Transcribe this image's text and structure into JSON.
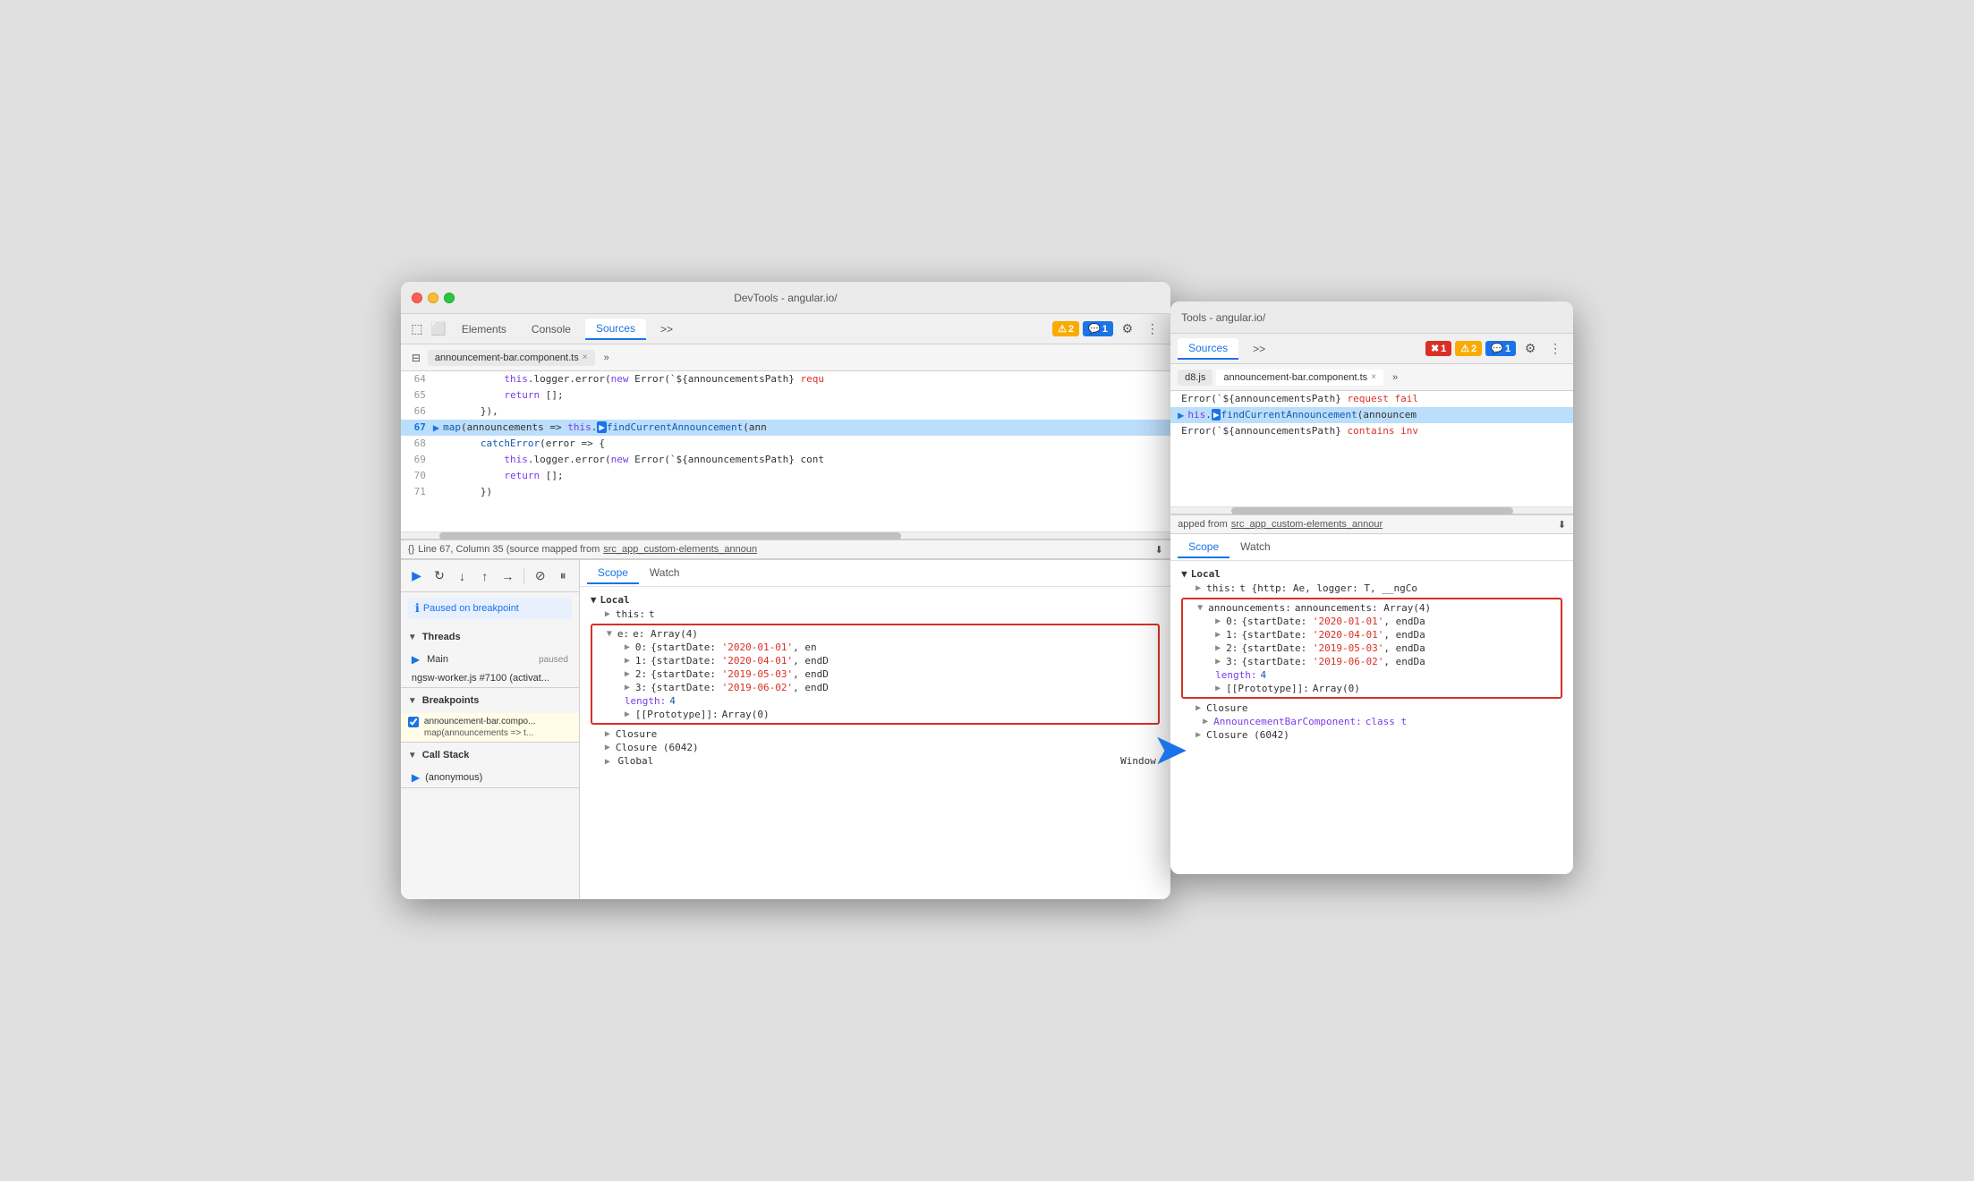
{
  "left_window": {
    "title": "DevTools - angular.io/",
    "tabs": [
      "Elements",
      "Console",
      "Sources",
      ">>"
    ],
    "active_tab": "Sources",
    "badges": [
      {
        "icon": "⚠",
        "count": "2",
        "type": "yellow"
      },
      {
        "icon": "💬",
        "count": "1",
        "type": "blue"
      }
    ],
    "file_tabs": [
      "announcement-bar.component.ts"
    ],
    "code_lines": [
      {
        "num": "64",
        "content": "            this.logger.error(new Error(`${announcementsPath} requ",
        "highlighted": false
      },
      {
        "num": "65",
        "content": "            return [];",
        "highlighted": false
      },
      {
        "num": "66",
        "content": "        }),",
        "highlighted": false
      },
      {
        "num": "67",
        "content": "        map(announcements => this.findCurrentAnnouncement(anno",
        "highlighted": true
      },
      {
        "num": "68",
        "content": "        catchError(error => {",
        "highlighted": false
      },
      {
        "num": "69",
        "content": "            this.logger.error(new Error(`${announcementsPath} cont",
        "highlighted": false
      },
      {
        "num": "70",
        "content": "            return [];",
        "highlighted": false
      },
      {
        "num": "71",
        "content": "        })",
        "highlighted": false
      }
    ],
    "status_bar": "Line 67, Column 35 (source mapped from src_app_custom-elements_announ",
    "debug_controls": [
      "resume",
      "step-over",
      "step-into",
      "step-out",
      "deactivate",
      "pause"
    ],
    "paused_label": "Paused on breakpoint",
    "threads_label": "Threads",
    "threads": [
      {
        "name": "Main",
        "status": "paused",
        "active": true
      },
      {
        "name": "ngsw-worker.js #7100 (activat...",
        "status": "",
        "active": false
      }
    ],
    "breakpoints_label": "Breakpoints",
    "breakpoints": [
      {
        "file": "announcement-bar.compo...",
        "code": "map(announcements => t...",
        "checked": true
      }
    ],
    "call_stack_label": "Call Stack",
    "call_stack": [
      {
        "name": "(anonymous)",
        "active": true
      }
    ],
    "scope_tabs": [
      "Scope",
      "Watch"
    ],
    "scope_active_tab": "Scope",
    "scope_local_label": "Local",
    "scope_this_label": "this: t",
    "scope_e_label": "e: Array(4)",
    "scope_items": [
      {
        "key": "▶ 0:",
        "val": "{startDate: '2020-01-01', en"
      },
      {
        "key": "▶ 1:",
        "val": "{startDate: '2020-04-01', endD"
      },
      {
        "key": "▶ 2:",
        "val": "{startDate: '2019-05-03', endD"
      },
      {
        "key": "▶ 3:",
        "val": "{startDate: '2019-06-02', endD"
      },
      {
        "key": "length:",
        "val": "4"
      },
      {
        "key": "▶ [[Prototype]]:",
        "val": "Array(0)"
      }
    ],
    "closure_label": "Closure",
    "closure2_label": "Closure (6042)",
    "global_label": "Global",
    "global_val": "Window"
  },
  "right_window": {
    "title": "Tools - angular.io/",
    "tabs": [
      "Sources",
      ">>"
    ],
    "active_tab": "Sources",
    "badges": [
      {
        "icon": "✖",
        "count": "1",
        "type": "red"
      },
      {
        "icon": "⚠",
        "count": "2",
        "type": "yellow"
      },
      {
        "icon": "💬",
        "count": "1",
        "type": "blue"
      }
    ],
    "file_tabs": [
      "d8.js",
      "announcement-bar.component.ts"
    ],
    "code_lines": [
      {
        "content": "Error(`${announcementsPath} request fail",
        "highlighted": false
      },
      {
        "content": "this.findCurrentAnnouncement(announcem",
        "highlighted": true
      },
      {
        "content": "Error(`${announcementsPath} contains inv",
        "highlighted": false
      }
    ],
    "status_bar": "apped from src_app_custom-elements_annour",
    "scope_tabs": [
      "Scope",
      "Watch"
    ],
    "scope_active_tab": "Scope",
    "scope_local_label": "Local",
    "scope_this_label": "this: t {http: Ae, logger: T, __ngCo",
    "scope_announcements_label": "announcements: Array(4)",
    "scope_items": [
      {
        "key": "▶ 0:",
        "val": "{startDate: '2020-01-01', endDa"
      },
      {
        "key": "▶ 1:",
        "val": "{startDate: '2020-04-01', endDa"
      },
      {
        "key": "▶ 2:",
        "val": "{startDate: '2019-05-03', endDa"
      },
      {
        "key": "▶ 3:",
        "val": "{startDate: '2019-06-02', endDa"
      },
      {
        "key": "length:",
        "val": "4"
      },
      {
        "key": "▶ [[Prototype]]:",
        "val": "Array(0)"
      }
    ],
    "closure_label": "Closure",
    "closure_ann_label": "AnnouncementBarComponent: class t",
    "closure2_label": "Closure (6042)"
  },
  "icons": {
    "chevron_right": "▶",
    "chevron_down": "▼",
    "close": "×",
    "gear": "⚙",
    "more": "⋮",
    "chevrons": "»",
    "resume": "▶",
    "step": "↷",
    "into": "↓",
    "out": "↑",
    "deactivate": "⊘",
    "pause": "⏸"
  }
}
